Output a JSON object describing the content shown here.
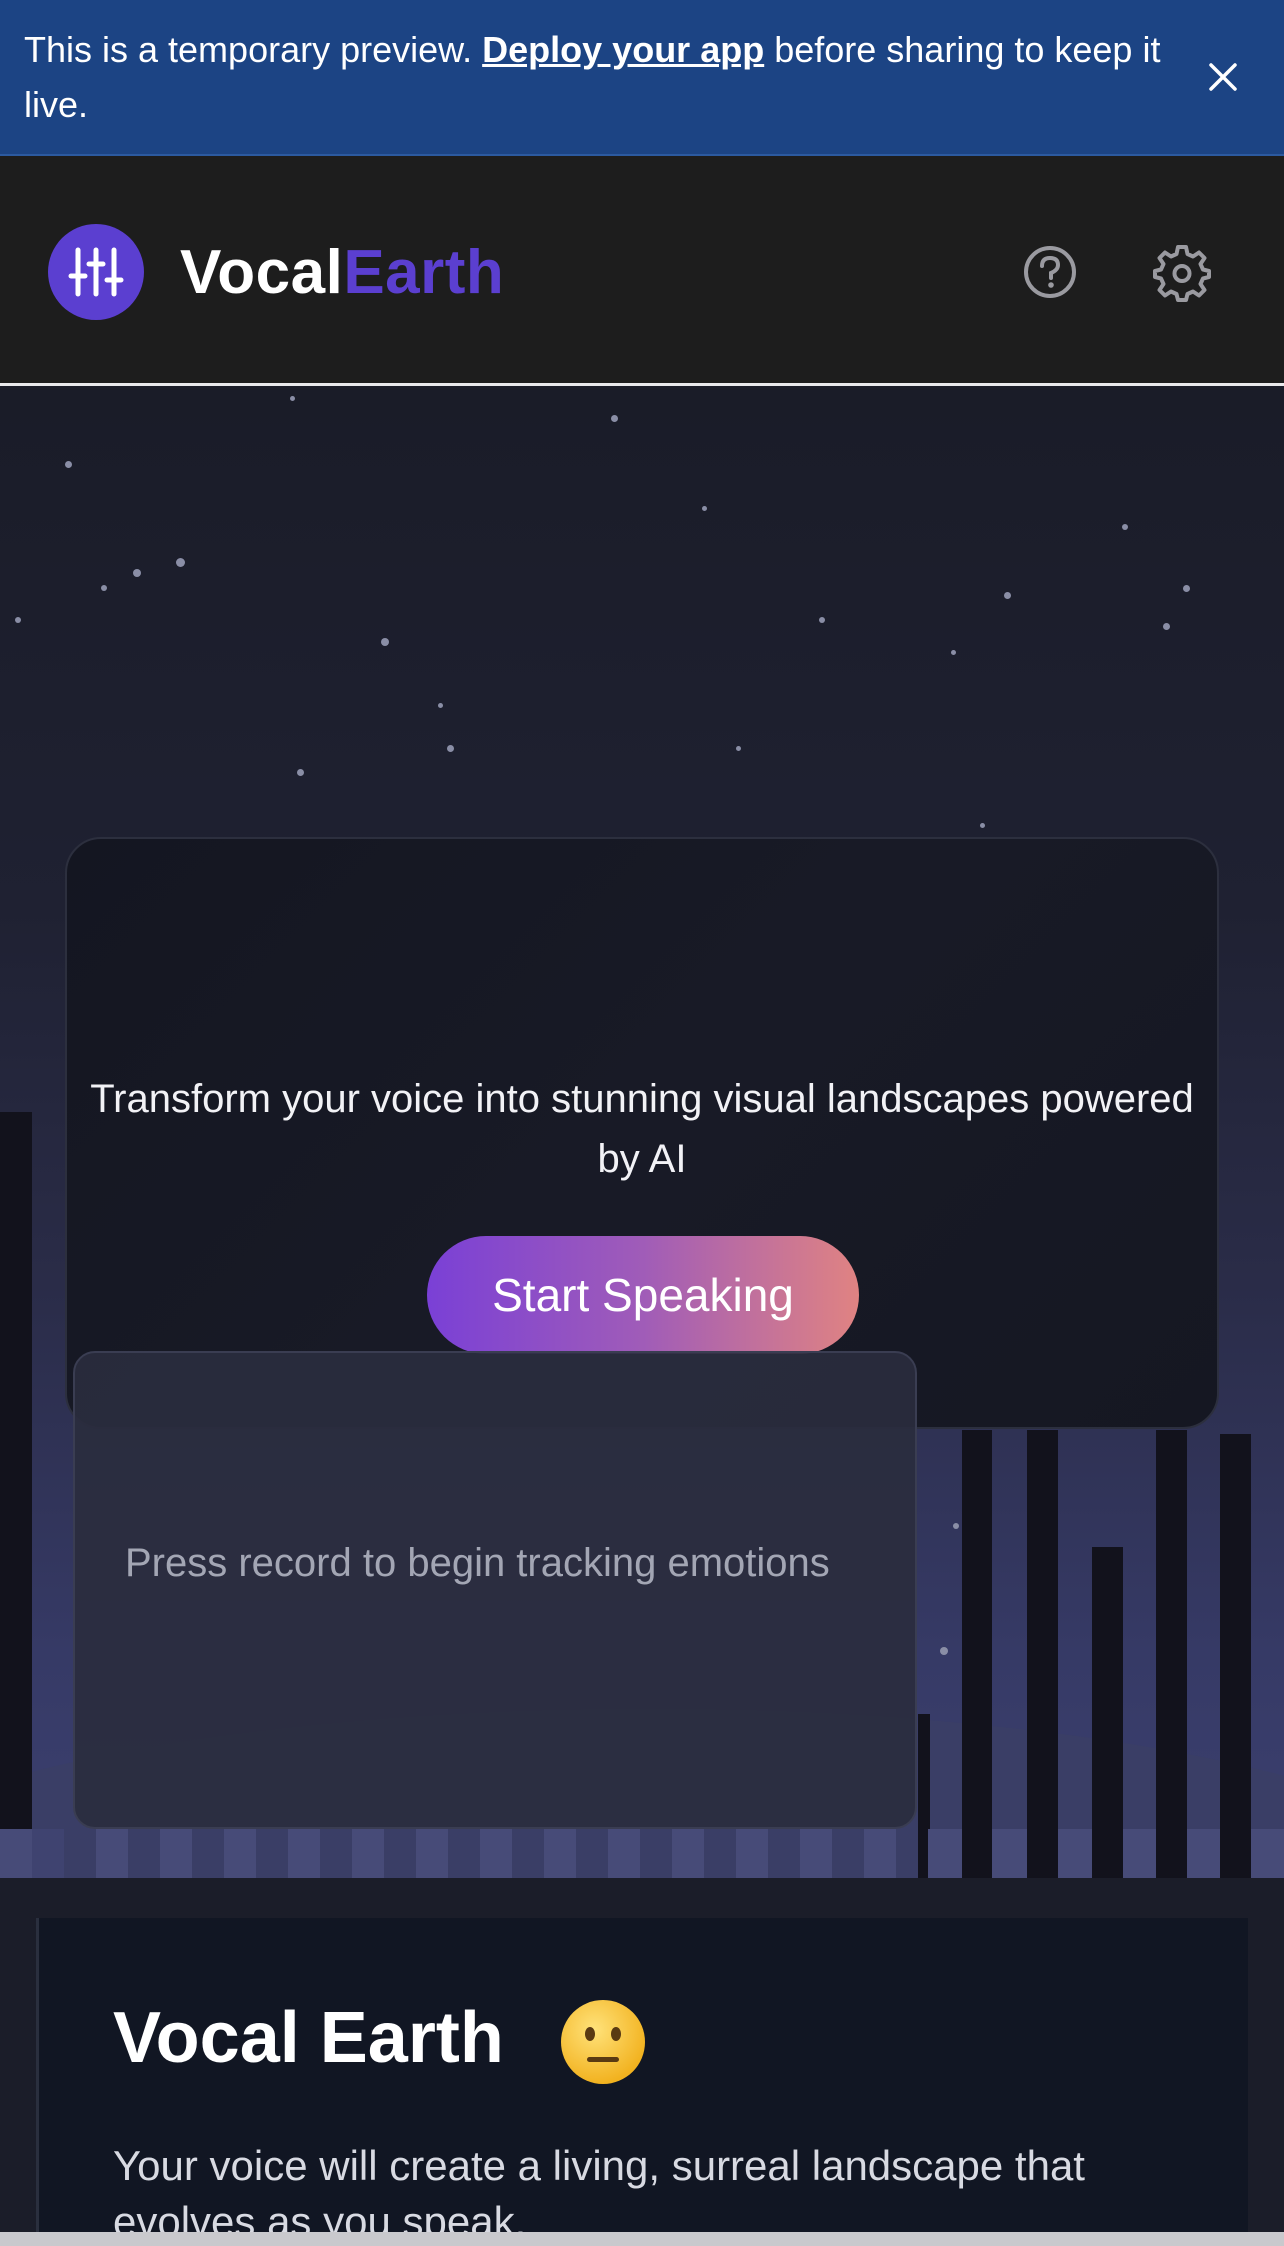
{
  "banner": {
    "text_before": "This is a temporary preview. ",
    "link_text": "Deploy your app",
    "text_after": " before sharing to keep it live.",
    "close_icon": "close-icon"
  },
  "header": {
    "brand_part1": "Vocal",
    "brand_part2": "Earth",
    "logo_icon": "equalizer-sliders-icon",
    "help_icon": "question-circle-icon",
    "settings_icon": "gear-icon",
    "accent_color": "#5b3fd0"
  },
  "hero": {
    "tagline": "Transform your voice into stunning visual landscapes powered by AI",
    "cta_label": "Start Speaking",
    "cta_gradient": [
      "#7a40d6",
      "#e08382"
    ]
  },
  "emotion_panel": {
    "placeholder": "Press record to begin tracking emotions"
  },
  "info": {
    "title": "Vocal Earth",
    "title_emoji": "neutral-face-emoji",
    "description": "Your voice will create a living, surreal landscape that evolves as you speak."
  }
}
